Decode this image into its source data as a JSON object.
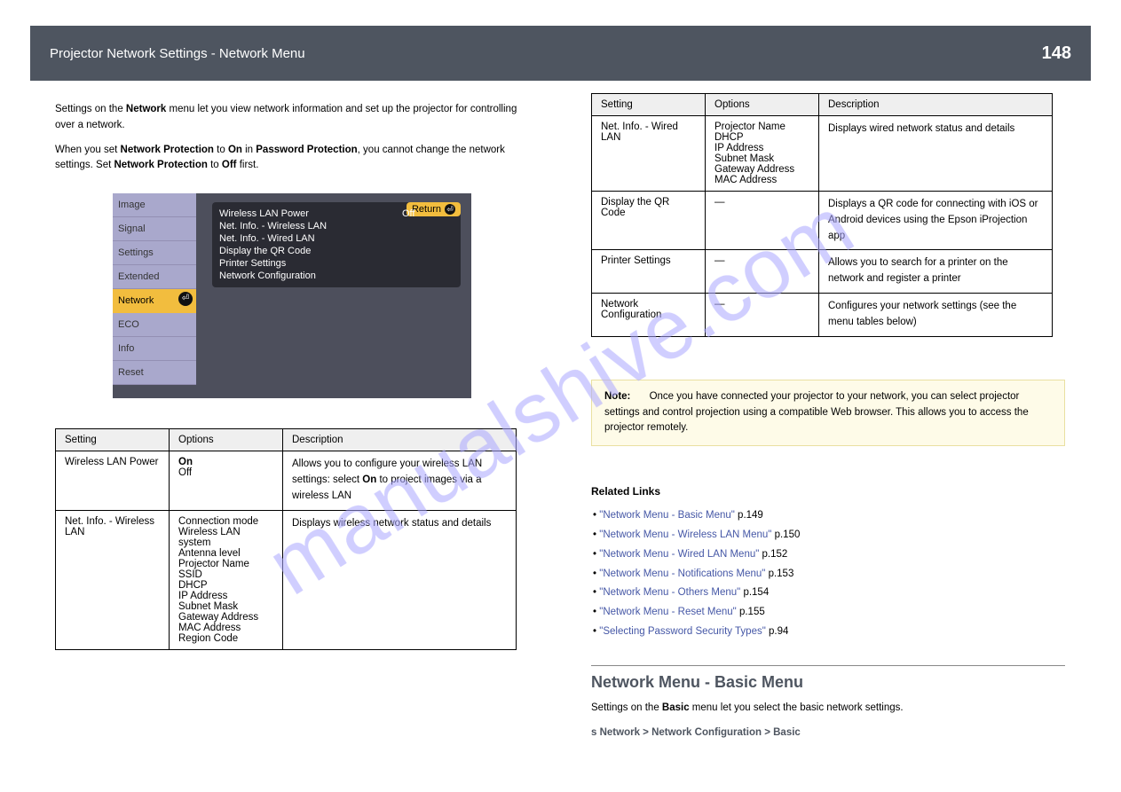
{
  "watermark": "manualshive.com",
  "header": {
    "breadcrumb_main": "Projector Network Settings - Network Menu",
    "page_number": "148"
  },
  "col_left": {
    "intro_prefix": "Settings on the ",
    "intro_bold": "Network",
    "intro_rest": " menu let you view network information and set up the projector for controlling over a network.",
    "protect_1": "When you set ",
    "protect_bold1": "Network Protection",
    "protect_2": " to ",
    "protect_bold2": "On",
    "protect_3": " in ",
    "protect_bold3": "Password Protection",
    "protect_4": ", you cannot change the network settings. Set ",
    "protect_bold4": "Network Protection",
    "protect_5": " to ",
    "protect_bold5": "Off",
    "protect_6": " first.",
    "table_headers": [
      "Setting",
      "Options",
      "Description"
    ],
    "rows": [
      {
        "setting": "Wireless LAN Power",
        "options_bold1": "On",
        "options_line2": "Off",
        "desc": "Allows you to configure your wireless LAN settings: select",
        "desc_bold": " On",
        "desc_rest": " to project images via a wireless LAN"
      },
      {
        "setting": "Net. Info. - Wireless LAN",
        "options": [
          "Connection mode",
          "Wireless LAN system",
          "Antenna level",
          "Projector Name",
          "SSID",
          "DHCP",
          "IP Address",
          "Subnet Mask",
          "Gateway Address",
          "MAC Address",
          "Region Code"
        ],
        "desc": "Displays wireless network status and details"
      }
    ]
  },
  "screenshot": {
    "tabs": [
      "Image",
      "Signal",
      "Settings",
      "Extended",
      "Network",
      "ECO",
      "Info",
      "Reset"
    ],
    "active_index": 4,
    "return_label": "Return",
    "panel_items": [
      {
        "label": "Wireless LAN Power",
        "value": "Off"
      },
      {
        "label": "Net. Info. - Wireless LAN",
        "value": ""
      },
      {
        "label": "Net. Info. - Wired LAN",
        "value": ""
      },
      {
        "label": "Display the QR Code",
        "value": ""
      },
      {
        "label": "Printer Settings",
        "value": ""
      },
      {
        "label": "Network Configuration",
        "value": ""
      }
    ]
  },
  "col_right": {
    "table_headers": [
      "Setting",
      "Options",
      "Description"
    ],
    "rows": [
      {
        "setting": "Net. Info. - Wired LAN",
        "options": [
          "Projector Name",
          "DHCP",
          "IP Address",
          "Subnet Mask",
          "Gateway Address",
          "MAC Address"
        ],
        "desc": "Displays wired network status and details"
      },
      {
        "setting": "Display the QR Code",
        "options": [
          "—"
        ],
        "desc": "Displays a QR code for connecting with iOS or Android devices using the Epson iProjection app"
      },
      {
        "setting": "Printer Settings",
        "options": [
          "—"
        ],
        "desc": "Allows you to search for a printer on the network and register a printer"
      },
      {
        "setting": "Network Configuration",
        "options": [
          "—"
        ],
        "desc": "Configures your network settings (see the menu tables below)"
      }
    ],
    "note_label": "Note:",
    "note_text": " Once you have connected your projector to your network, you can select projector settings and control projection using a compatible Web browser. This allows you to access the projector remotely.",
    "related_heading": "Related Links",
    "related_items": [
      {
        "text": "\"Network Menu - Basic Menu\"",
        "page": "p.149"
      },
      {
        "text": "\"Network Menu - Wireless LAN Menu\"",
        "page": "p.150"
      },
      {
        "text": "\"Network Menu - Wired LAN Menu\"",
        "page": "p.152"
      },
      {
        "text": "\"Network Menu - Notifications Menu\"",
        "page": "p.153"
      },
      {
        "text": "\"Network Menu - Others Menu\"",
        "page": "p.154"
      },
      {
        "text": "\"Network Menu - Reset Menu\"",
        "page": "p.155"
      },
      {
        "text": "\"Selecting Password Security Types\"",
        "page": "p.94"
      }
    ],
    "section_title": "Network Menu - Basic Menu",
    "section_p1_1": "Settings on the ",
    "section_p1_b": "Basic",
    "section_p1_2": " menu let you select the basic network settings.",
    "section_nav": "s  Network > Network Configuration > Basic"
  }
}
